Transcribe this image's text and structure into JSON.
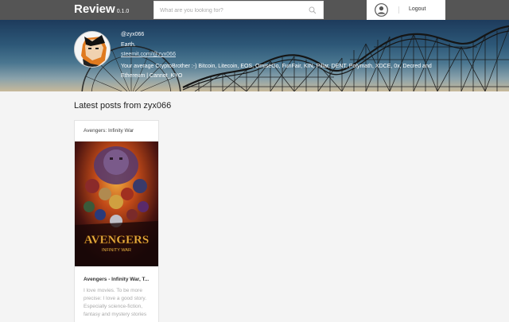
{
  "app": {
    "name": "Review",
    "version": "0.1.0"
  },
  "search": {
    "placeholder": "What are you looking for?"
  },
  "user_menu": {
    "logout_label": "Logout"
  },
  "profile": {
    "username": "@zyx066",
    "location": "Earth.",
    "link": "steemit.com/@zyx066",
    "bio": "Your average CryptoBrother :-) Bitcoin, Litecoin, EOS, OmiseGo, FunFair, KIN, Pillar, DENT, Polymath, XDCE, 0x, Decred and Ethereum | Cannot_KYO"
  },
  "posts_section": {
    "title": "Latest posts from zyx066",
    "posts": [
      {
        "category": "Avengers: Infinity War",
        "poster_title": "AVENGERS",
        "poster_subtitle": "INFINITY WAR",
        "title": "Avengers - Infinity War, T...",
        "excerpt": "I love movies. To be more precise: I love a good story. Especially science-fiction, fantasy and mystery stories"
      }
    ]
  },
  "colors": {
    "topbar": "#555555",
    "page_bg": "#f4f4f4"
  }
}
